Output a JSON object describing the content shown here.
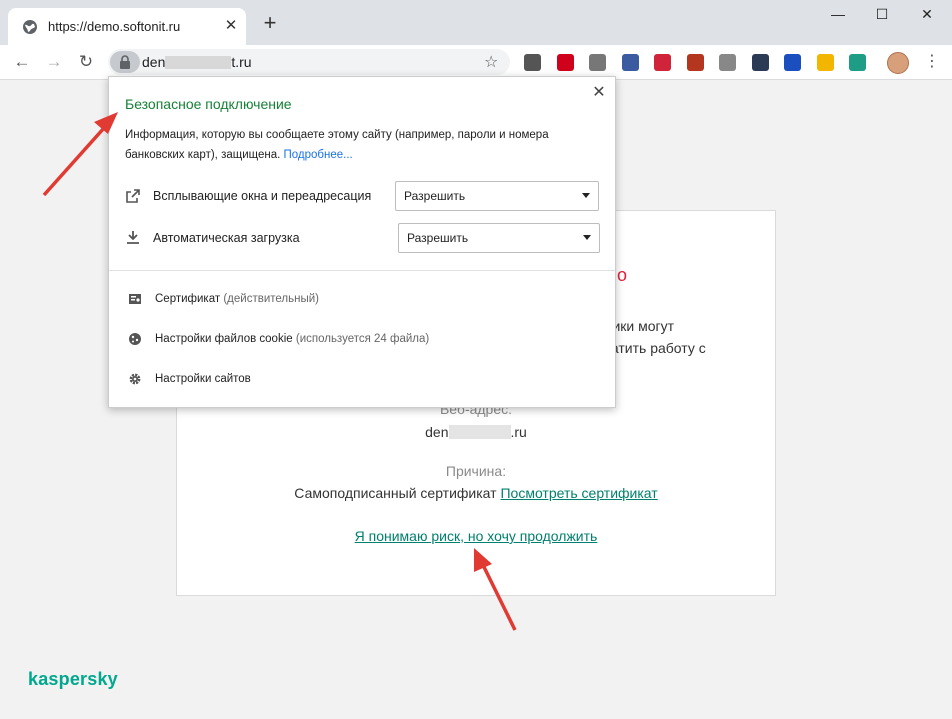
{
  "tab": {
    "title": "https://demo.softonit.ru",
    "close": "✕"
  },
  "newtab": "+",
  "window": {
    "minimize": "—",
    "maximize": "☐",
    "close": "✕"
  },
  "nav": {
    "back": "←",
    "forward": "→",
    "reload": "↻"
  },
  "omnibox": {
    "url_prefix": "den",
    "url_suffix": "t.ru",
    "star": "☆"
  },
  "extensions": [
    {
      "name": "mail-icon",
      "color": "#555555"
    },
    {
      "name": "adblock-icon",
      "color": "#d0021b"
    },
    {
      "name": "sync-icon",
      "color": "#777777"
    },
    {
      "name": "screenshot-icon",
      "color": "#3a5ba0"
    },
    {
      "name": "diamond-icon",
      "color": "#d0243a"
    },
    {
      "name": "mascot-icon",
      "color": "#b5361f"
    },
    {
      "name": "shield-icon",
      "color": "#888888"
    },
    {
      "name": "vpn-icon",
      "color": "#2b3b55"
    },
    {
      "name": "bookmark-icon",
      "color": "#1b4fbf"
    },
    {
      "name": "star-ext-icon",
      "color": "#f2b500"
    },
    {
      "name": "camera-icon",
      "color": "#1e9d86"
    }
  ],
  "menu": "⋮",
  "popup": {
    "title": "Безопасное подключение",
    "description": "Информация, которую вы сообщаете этому сайту (например, пароли и номера банковских карт), защищена.",
    "more_link": "Подробнее...",
    "close": "✕",
    "permissions": [
      {
        "label": "Всплывающие окна и переадресация",
        "value": "Разрешить"
      },
      {
        "label": "Автоматическая загрузка",
        "value": "Разрешить"
      }
    ],
    "items": [
      {
        "label": "Сертификат",
        "sub": "(действительный)"
      },
      {
        "label": "Настройки файлов cookie",
        "sub": "(используется 24 файла)"
      },
      {
        "label": "Настройки сайтов",
        "sub": ""
      }
    ]
  },
  "page": {
    "title_fragment": "ено",
    "text_line1_fragment": "нники могут",
    "text_line2_fragment": "кратить работу с",
    "address_label": "Веб-адрес:",
    "address_prefix": "den",
    "address_suffix": ".ru",
    "reason_label": "Причина:",
    "reason_text": "Самоподписанный сертификат",
    "view_certificate": "Посмотреть сертификат",
    "proceed_link": "Я понимаю риск, но хочу продолжить"
  },
  "brand": "kaspersky",
  "colors": {
    "popup_title": "#188038",
    "link_teal": "#00806d",
    "brand": "#00a88e",
    "alert_red": "#e0203a",
    "arrow": "#e03a32"
  }
}
